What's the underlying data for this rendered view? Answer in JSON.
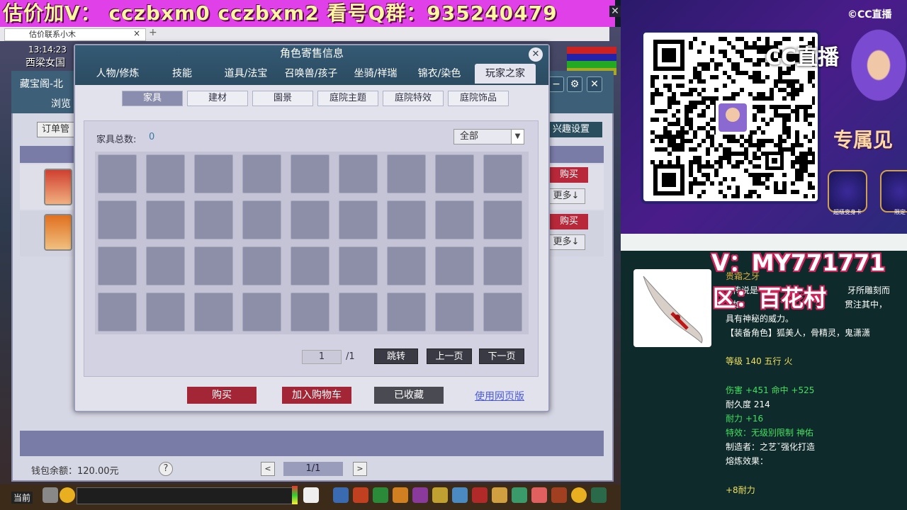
{
  "banner": {
    "text": "估价加V： cczbxm0   cczbxm2   看号Q群：935240479",
    "close": "✕"
  },
  "browser_tab": {
    "label": "估价联系小木",
    "close": "×",
    "plus": "+"
  },
  "hud": {
    "clock": "13:14:23",
    "location": "西梁女国"
  },
  "bg_window": {
    "title": "藏宝阁-北",
    "browse": "浏览",
    "order_label": "订单管",
    "interest_label": "兴趣设置",
    "buy_label": "购买",
    "more_label": "更多↓",
    "wallet": "钱包余额：120.00元",
    "help": "?",
    "pager": "1/1",
    "prev": "<",
    "next": ">",
    "btn_min": "−",
    "btn_gear": "⚙",
    "btn_close": "✕"
  },
  "dialog": {
    "title": "角色寄售信息",
    "close": "✕",
    "main_tabs": [
      "人物/修炼",
      "技能",
      "道具/法宝",
      "召唤兽/孩子",
      "坐骑/祥瑞",
      "锦衣/染色",
      "玩家之家"
    ],
    "active_main_tab": 6,
    "sub_tabs": [
      "家具",
      "建材",
      "園景",
      "庭院主题",
      "庭院特效",
      "庭院饰品"
    ],
    "active_sub_tab": 0,
    "count_label": "家具总数:",
    "count_value": "0",
    "filter_value": "全部",
    "page_current": "1",
    "page_total": "/1",
    "jump": "跳转",
    "prev_page": "上一页",
    "next_page": "下一页",
    "buy": "购买",
    "add_cart": "加入购物车",
    "favorited": "已收藏",
    "web_version": "使用网页版",
    "slot_count": 36
  },
  "toolbar": {
    "chat_label": "当前"
  },
  "right_panel": {
    "cc_logo": "©CC直播",
    "cc_live": "CC直播",
    "exclusive": "专属见",
    "badge_1": "超级变身卡",
    "badge_2": "限定"
  },
  "tooltip": {
    "stream_v": "V：MY771771",
    "stream_area": "区：百花村",
    "name": "贵霜之牙",
    "desc_1": "传说是",
    "desc_1b": "牙所雕刻而",
    "desc_2": "如",
    "desc_2b": "贯注其中，",
    "desc_3": "具有神秘的威力。",
    "roles": "【装备角色】狐美人，骨精灵，鬼潇潇",
    "level": "等级 140 五行 火",
    "damage": "伤害 +451 命中 +525",
    "durability": "耐久度 214",
    "endurance": "耐力 +16",
    "effect": "特效：无级别限制 神佑",
    "maker": "制造者：之艺ˇ强化打造",
    "refine": "熔炼效果：",
    "refine_val": "+8耐力"
  },
  "colors": {
    "accent_red": "#b8283a",
    "banner_magenta": "#e040e8",
    "panel_teal": "#2b4b61"
  }
}
